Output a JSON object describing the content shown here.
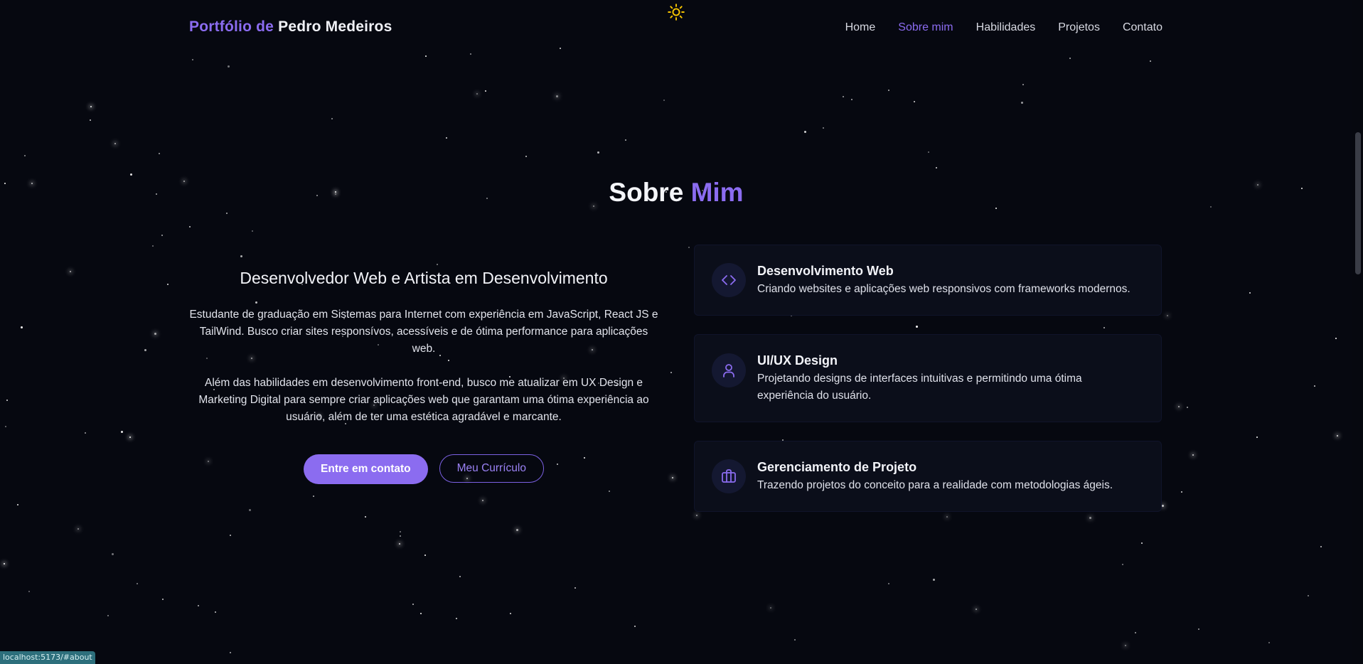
{
  "brand": {
    "prefix": "Portfólio de",
    "name": "Pedro Medeiros"
  },
  "theme_toggle_icon": "sun-icon",
  "nav": [
    {
      "label": "Home",
      "active": false
    },
    {
      "label": "Sobre mim",
      "active": true
    },
    {
      "label": "Habilidades",
      "active": false
    },
    {
      "label": "Projetos",
      "active": false
    },
    {
      "label": "Contato",
      "active": false
    }
  ],
  "section": {
    "title_part1": "Sobre",
    "title_part2": "Mim"
  },
  "about": {
    "heading": "Desenvolvedor Web e Artista em Desenvolvimento",
    "paragraph1": "Estudante de graduação em Sistemas para Internet com experiência em JavaScript, React JS e TailWind. Busco criar sites responsívos, acessíveis e de ótima performance para aplicações web.",
    "paragraph2": "Além das habilidades em desenvolvimento front-end, busco me atualizar em UX Design e Marketing Digital para sempre criar aplicações web que garantam uma ótima experiência ao usuário, além de ter uma estética agradável e marcante.",
    "contact_button": "Entre em contato",
    "resume_button": "Meu Currículo"
  },
  "cards": [
    {
      "icon": "code-icon",
      "title": "Desenvolvimento Web",
      "description": "Criando websites e aplicações web responsivos com frameworks modernos."
    },
    {
      "icon": "user-icon",
      "title": "UI/UX Design",
      "description": "Projetando designs de interfaces intuitivas e permitindo uma ótima experiência do usuário."
    },
    {
      "icon": "briefcase-icon",
      "title": "Gerenciamento de Projeto",
      "description": "Trazendo projetos do conceito para a realidade com metodologias ágeis."
    }
  ],
  "status_bar_url": "localhost:5173/#about",
  "colors": {
    "accent": "#8b6cf0",
    "background": "#060810",
    "card": "#0b0e1a"
  }
}
